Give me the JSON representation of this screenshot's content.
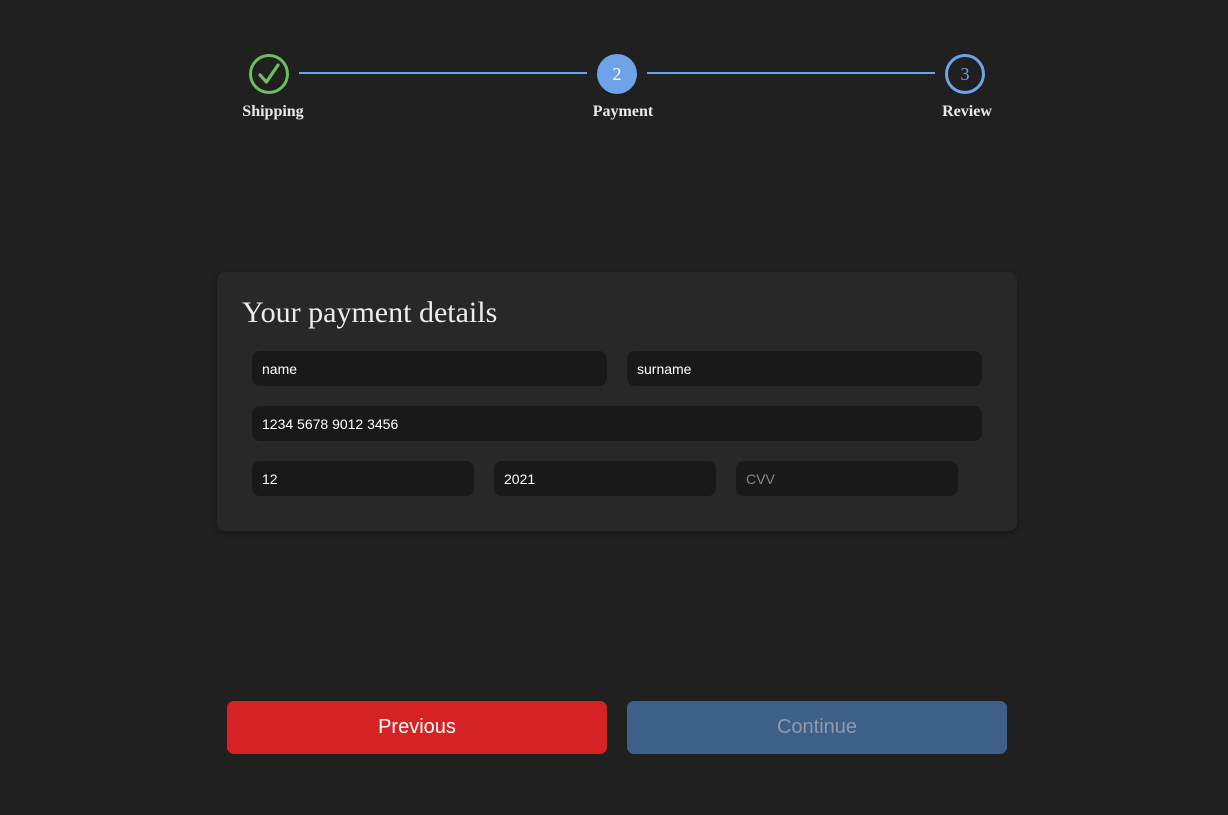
{
  "stepper": {
    "steps": [
      {
        "label": "Shipping",
        "number": "",
        "state": "completed",
        "icon": "checkmark-icon"
      },
      {
        "label": "Payment",
        "number": "2",
        "state": "active"
      },
      {
        "label": "Review",
        "number": "3",
        "state": "pending"
      }
    ]
  },
  "payment": {
    "title": "Your payment details",
    "fields": {
      "name": {
        "value": "name",
        "placeholder": ""
      },
      "surname": {
        "value": "surname",
        "placeholder": ""
      },
      "card_number": {
        "value": "1234 5678 9012 3456",
        "placeholder": ""
      },
      "exp_month": {
        "value": "12",
        "placeholder": ""
      },
      "exp_year": {
        "value": "2021",
        "placeholder": ""
      },
      "cvv": {
        "value": "",
        "placeholder": "CVV"
      }
    }
  },
  "actions": {
    "previous_label": "Previous",
    "continue_label": "Continue",
    "continue_disabled": true
  },
  "colors": {
    "background": "#202020",
    "card": "#282828",
    "input": "#191919",
    "completed_green": "#6cbf5c",
    "accent_blue": "#6ea3e8",
    "previous_red": "#d62222",
    "continue_disabled_blue": "#3e5f88"
  }
}
